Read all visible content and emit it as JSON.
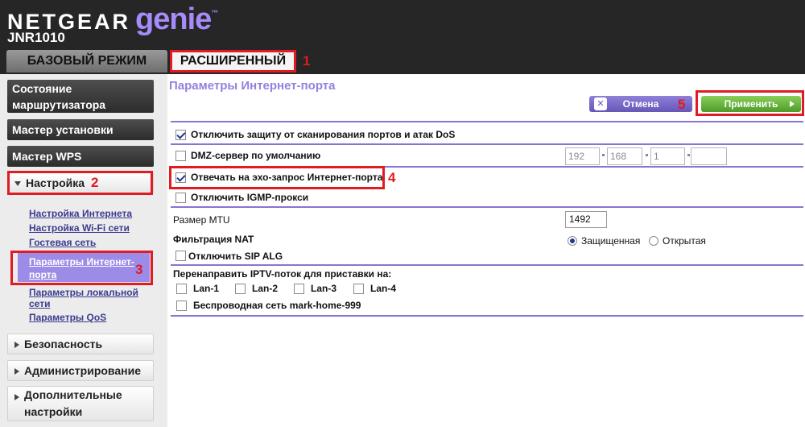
{
  "header": {
    "brand": "NETGEAR",
    "product": "genie",
    "tm": "™",
    "model": "JNR1010",
    "tabs": {
      "basic": "БАЗОВЫЙ РЕЖИМ",
      "advanced": "РАСШИРЕННЫЙ"
    }
  },
  "markers": [
    "1",
    "2",
    "3",
    "4",
    "5"
  ],
  "sidebar": {
    "router_status": "Состояние маршрутизатора",
    "setup_wizard": "Мастер установки",
    "wps_wizard": "Мастер WPS",
    "setup": "Настройка",
    "setup_items": [
      "Настройка Интернета",
      "Настройка Wi-Fi сети",
      "Гостевая сеть",
      "Параметры Интернет-порта",
      "Параметры локальной сети",
      "Параметры QoS"
    ],
    "security": "Безопасность",
    "administration": "Администрирование",
    "advanced_settings": "Дополнительные настройки"
  },
  "main": {
    "title": "Параметры Интернет-порта",
    "cancel_label": "Отмена",
    "cancel_icon": "✕",
    "apply_label": "Применить",
    "disable_scan_protect": {
      "label": "Отключить защиту от сканирования портов и атак DoS",
      "checked": true
    },
    "dmz": {
      "label": "DMZ-сервер по умолчанию",
      "checked": false,
      "ip": [
        "192",
        "168",
        "1",
        ""
      ]
    },
    "respond_ping": {
      "label": "Отвечать на эхо-запрос Интернет-порта",
      "checked": true
    },
    "disable_igmp": {
      "label": "Отключить IGMP-прокси",
      "checked": false
    },
    "mtu": {
      "label": "Размер MTU",
      "value": "1492"
    },
    "nat": {
      "label": "Фильтрация NAT",
      "secured": "Защищенная",
      "open": "Открытая",
      "selected": "secured"
    },
    "disable_sip": {
      "label": "Отключить SIP ALG",
      "checked": false
    },
    "iptv": {
      "label": "Перенаправить IPTV-поток для приставки на:",
      "lans": [
        "Lan-1",
        "Lan-2",
        "Lan-3",
        "Lan-4"
      ],
      "wireless": "Беспроводная сеть mark-home-999"
    }
  },
  "colors": {
    "accent_purple": "#9580e0",
    "highlight_red": "#e11b22",
    "apply_green": "#5aa832",
    "header_dark": "#262626"
  }
}
